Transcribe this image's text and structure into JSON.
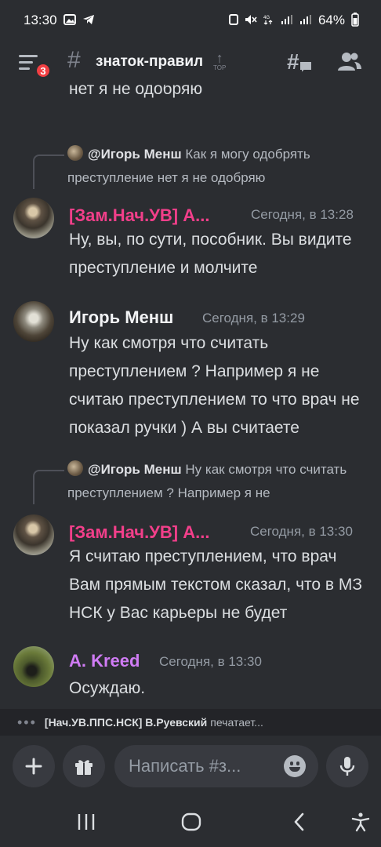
{
  "status_bar": {
    "time": "13:30",
    "battery": "64%"
  },
  "header": {
    "badge_count": "3",
    "channel_name": "знаток-правил",
    "top_label": "TOP"
  },
  "messages": {
    "prev_tail": "нет я не одобряю",
    "reply1": {
      "author": "@Игорь Менш",
      "text": "Как я могу одобрять преступление нет я не одобряю"
    },
    "msg1": {
      "author": "[Зам.Нач.УВ] А...",
      "author_color": "#f23f8a",
      "time": "Сегодня, в 13:28",
      "text": "Ну, вы, по сути, пособник. Вы видите преступление и молчите"
    },
    "msg2": {
      "author": "Игорь Менш",
      "author_color": "#f2f3f5",
      "time": "Сегодня, в 13:29",
      "text": "Ну как смотря что считать преступлением ? Например я не считаю преступлением то что врач не показал ручки ) А вы считаете"
    },
    "reply2": {
      "author": "@Игорь Менш",
      "text": "Ну как смотря что считать преступлением ? Например я не"
    },
    "msg3": {
      "author": "[Зам.Нач.УВ] А...",
      "author_color": "#f23f8a",
      "time": "Сегодня, в 13:30",
      "text": "Я считаю преступлением, что врач Вам прямым текстом сказал, что в МЗ НСК у Вас карьеры не будет"
    },
    "msg4": {
      "author": "А. Kreed",
      "author_color": "#d07cf5",
      "time": "Сегодня, в 13:30",
      "text": "Осуждаю."
    }
  },
  "typing": {
    "name": "[Нач.УВ.ППС.НСК] В.Руевский",
    "suffix": "печатает..."
  },
  "input": {
    "placeholder": "Написать #з..."
  },
  "icons": {
    "menu": "hamburger-icon",
    "threads": "threads-icon",
    "members": "members-icon",
    "add": "plus-icon",
    "gift": "gift-icon",
    "emoji": "emoji-icon",
    "mic": "microphone-icon",
    "recents": "recents-icon",
    "home": "home-icon",
    "back": "back-icon",
    "accessibility": "accessibility-icon"
  }
}
